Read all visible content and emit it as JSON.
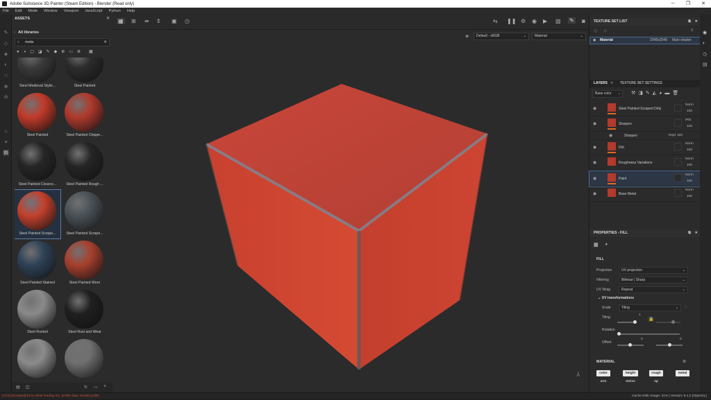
{
  "window": {
    "title": "Adobe Substance 3D Painter (Steam Edition) - Blender (Read only)"
  },
  "menu": [
    "File",
    "Edit",
    "Mode",
    "Window",
    "Viewport",
    "JavaScript",
    "Python",
    "Help"
  ],
  "assets": {
    "title": "ASSETS",
    "library": "All libraries",
    "search_value": "meta",
    "items": [
      {
        "label": "Steel Medieval Styliz...",
        "color": "#3a3a3a"
      },
      {
        "label": "Steel Painted",
        "color": "#2c2c2c"
      },
      {
        "label": "Steel Painted",
        "color": "#c23a2a"
      },
      {
        "label": "Steel Painted Chippe...",
        "color": "#b0392c"
      },
      {
        "label": "Steel Painted Clearco...",
        "color": "#262626"
      },
      {
        "label": "Steel Painted Rough ...",
        "color": "#252525"
      },
      {
        "label": "Steel Painted Scrape...",
        "color": "#c4412d"
      },
      {
        "label": "Steel Painted Scrape...",
        "color": "#4a5258"
      },
      {
        "label": "Steel Painted Stained",
        "color": "#2e4257"
      },
      {
        "label": "Steel Painted Worn",
        "color": "#a8402e"
      },
      {
        "label": "Steel Rusted",
        "color": "#8a8a8a"
      },
      {
        "label": "Steel Rust and Wear",
        "color": "#1f1f1f"
      },
      {
        "label": "",
        "color": "#8b8b8b"
      },
      {
        "label": "",
        "color": "#6f6f6f"
      }
    ]
  },
  "viewport": {
    "colorspace": "Default - sRGB",
    "mode": "Material"
  },
  "texture_set_list": {
    "title": "TEXTURE SET LIST",
    "rows": [
      {
        "name": "Material",
        "size": "2048x2048",
        "shader": "Main shader"
      }
    ]
  },
  "layers": {
    "tab_layers": "LAYERS",
    "tab_settings": "TEXTURE SET SETTINGS",
    "channel": "Base color",
    "items": [
      {
        "name": "Steel Painted Scraped Dirty",
        "blend": "Norm",
        "opacity": "100"
      },
      {
        "name": "Sharpen",
        "blend": "Pthr",
        "opacity": "100"
      },
      {
        "name": "Sharpen",
        "blend": "Repl",
        "opacity": "100"
      },
      {
        "name": "Dirt",
        "blend": "Norm",
        "opacity": "100"
      },
      {
        "name": "Roughness Variations",
        "blend": "Norm",
        "opacity": "100"
      },
      {
        "name": "Paint",
        "blend": "Norm",
        "opacity": "100"
      },
      {
        "name": "Base Metal",
        "blend": "Norm",
        "opacity": "100"
      }
    ]
  },
  "properties": {
    "title": "PROPERTIES - FILL",
    "section": "FILL",
    "projection_label": "Projection",
    "projection": "UV projection",
    "filtering_label": "Filtering",
    "filtering": "Bilinear | Sharp",
    "uvwrap_label": "UV Wrap",
    "uvwrap": "Repeat",
    "uvtrans": "UV transformations",
    "scale_label": "Scale",
    "scale": "Tiling",
    "tiling_label": "Tiling",
    "tiling_val": "1",
    "rotation_label": "Rotation",
    "offset_label": "Offset",
    "offset_x": "0",
    "offset_y": "0",
    "material_label": "MATERIAL",
    "channels_on": [
      "color",
      "height",
      "rough",
      "metal"
    ],
    "channels_off": [
      "emiss",
      "op"
    ],
    "arm": "arm"
  },
  "status": {
    "error": "[ACS] [Scripted] Error while loading XX: profile data: invalid profile",
    "right": "Cache Disk Usage: 31% | Version: 9.1.2 (OpenGL)"
  }
}
